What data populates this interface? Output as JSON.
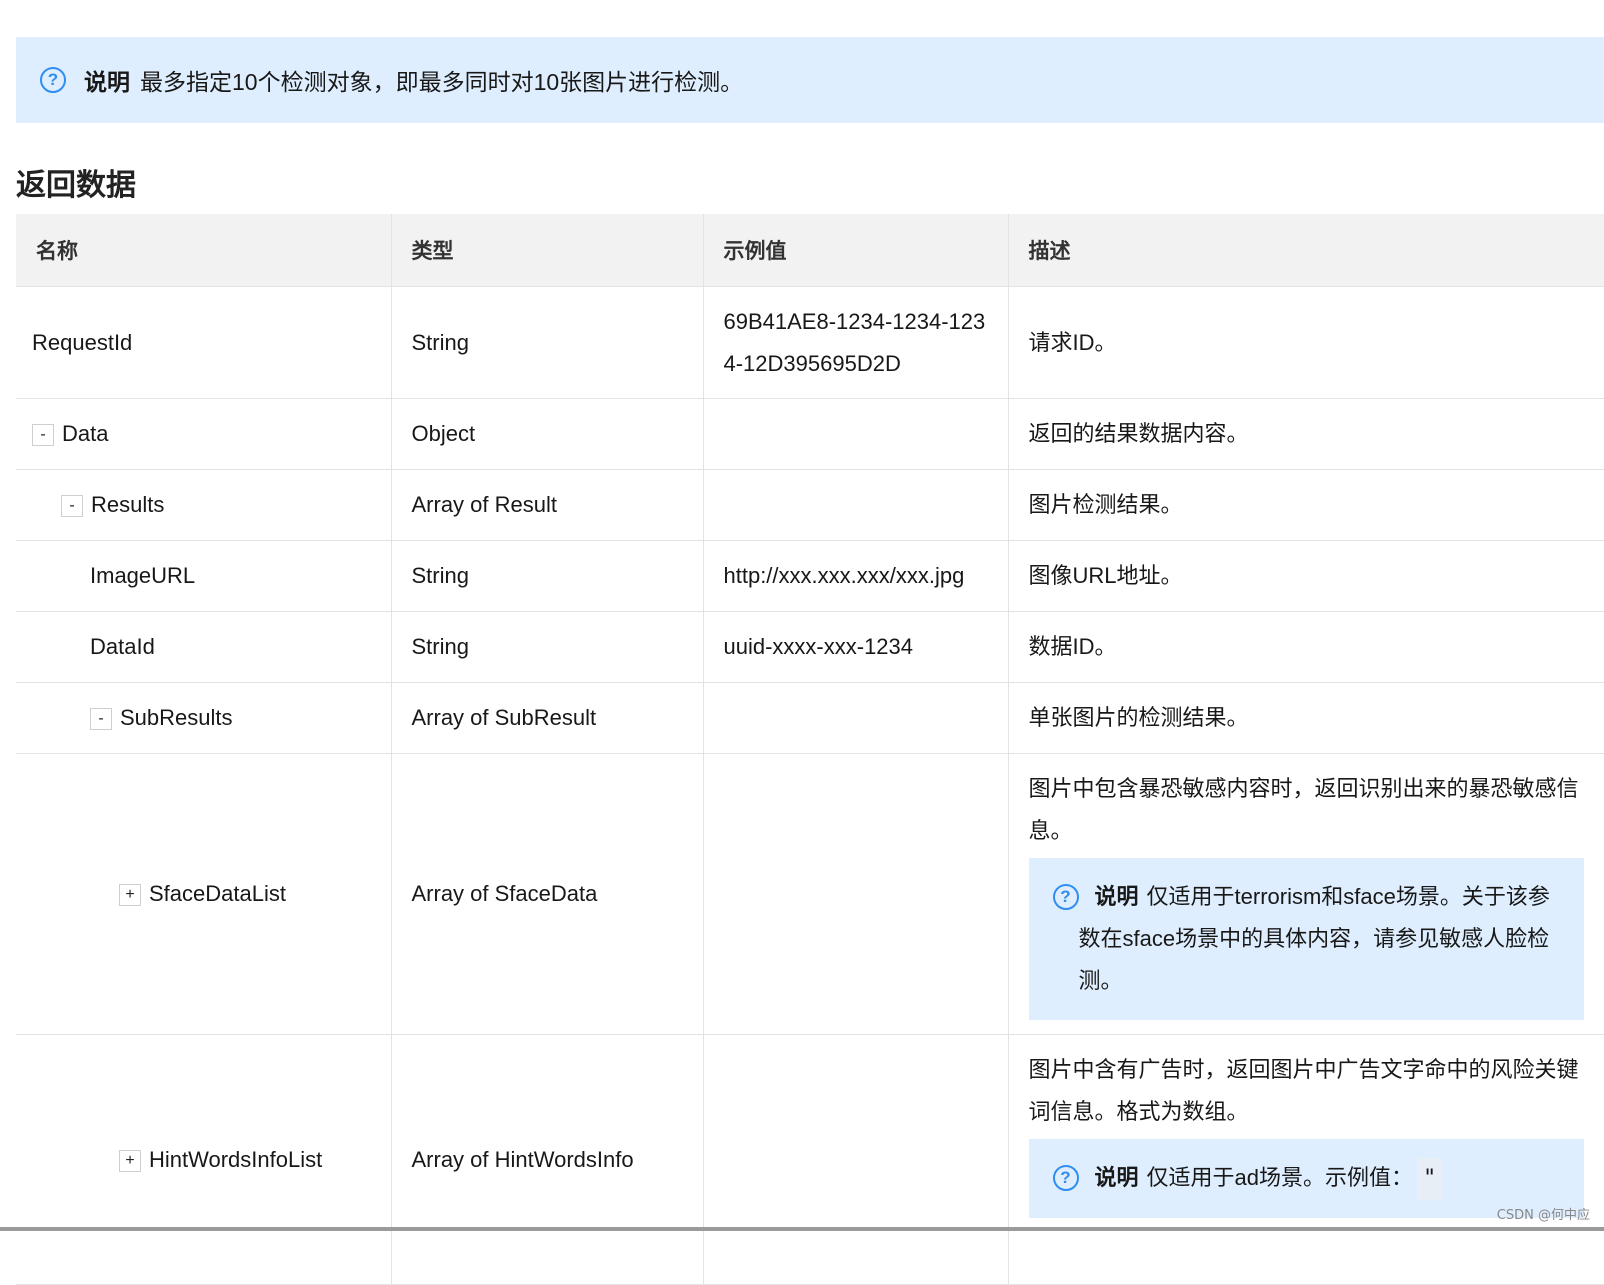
{
  "top_note": {
    "label": "说明",
    "text": "最多指定10个检测对象，即最多同时对10张图片进行检测。"
  },
  "section_title": "返回数据",
  "table": {
    "headers": [
      "名称",
      "类型",
      "示例值",
      "描述"
    ],
    "rows": [
      {
        "toggle": "",
        "name": "RequestId",
        "type": "String",
        "example": "69B41AE8-1234-1234-1234-12D395695D2D",
        "desc": "请求ID。"
      },
      {
        "toggle": "-",
        "name": "Data",
        "type": "Object",
        "example": "",
        "desc": "返回的结果数据内容。"
      },
      {
        "toggle": "-",
        "name": "Results",
        "type": "Array of Result",
        "example": "",
        "desc": "图片检测结果。"
      },
      {
        "toggle": "",
        "name": "ImageURL",
        "type": "String",
        "example": "http://xxx.xxx.xxx/xxx.jpg",
        "desc": "图像URL地址。"
      },
      {
        "toggle": "",
        "name": "DataId",
        "type": "String",
        "example": "uuid-xxxx-xxx-1234",
        "desc": "数据ID。"
      },
      {
        "toggle": "-",
        "name": "SubResults",
        "type": "Array of SubResult",
        "example": "",
        "desc": "单张图片的检测结果。"
      },
      {
        "toggle": "+",
        "name": "SfaceDataList",
        "type": "Array of SfaceData",
        "example": "",
        "desc": "图片中包含暴恐敏感内容时，返回识别出来的暴恐敏感信息。",
        "note_label": "说明",
        "note_text": "仅适用于terrorism和sface场景。关于该参数在sface场景中的具体内容，请参见敏感人脸检测。"
      },
      {
        "toggle": "+",
        "name": "HintWordsInfoList",
        "type": "Array of HintWordsInfo",
        "example": "",
        "desc": "图片中含有广告时，返回图片中广告文字命中的风险关键词信息。格式为数组。",
        "note_label": "说明",
        "note_text": "仅适用于ad场景。示例值：",
        "note_code": "\""
      }
    ]
  },
  "watermark": "CSDN @何中应",
  "colors": {
    "note_bg": "#dfeefe",
    "icon": "#2f8ef0",
    "header_bg": "#f2f2f2"
  },
  "icons": {
    "help": "question-circle-icon"
  }
}
